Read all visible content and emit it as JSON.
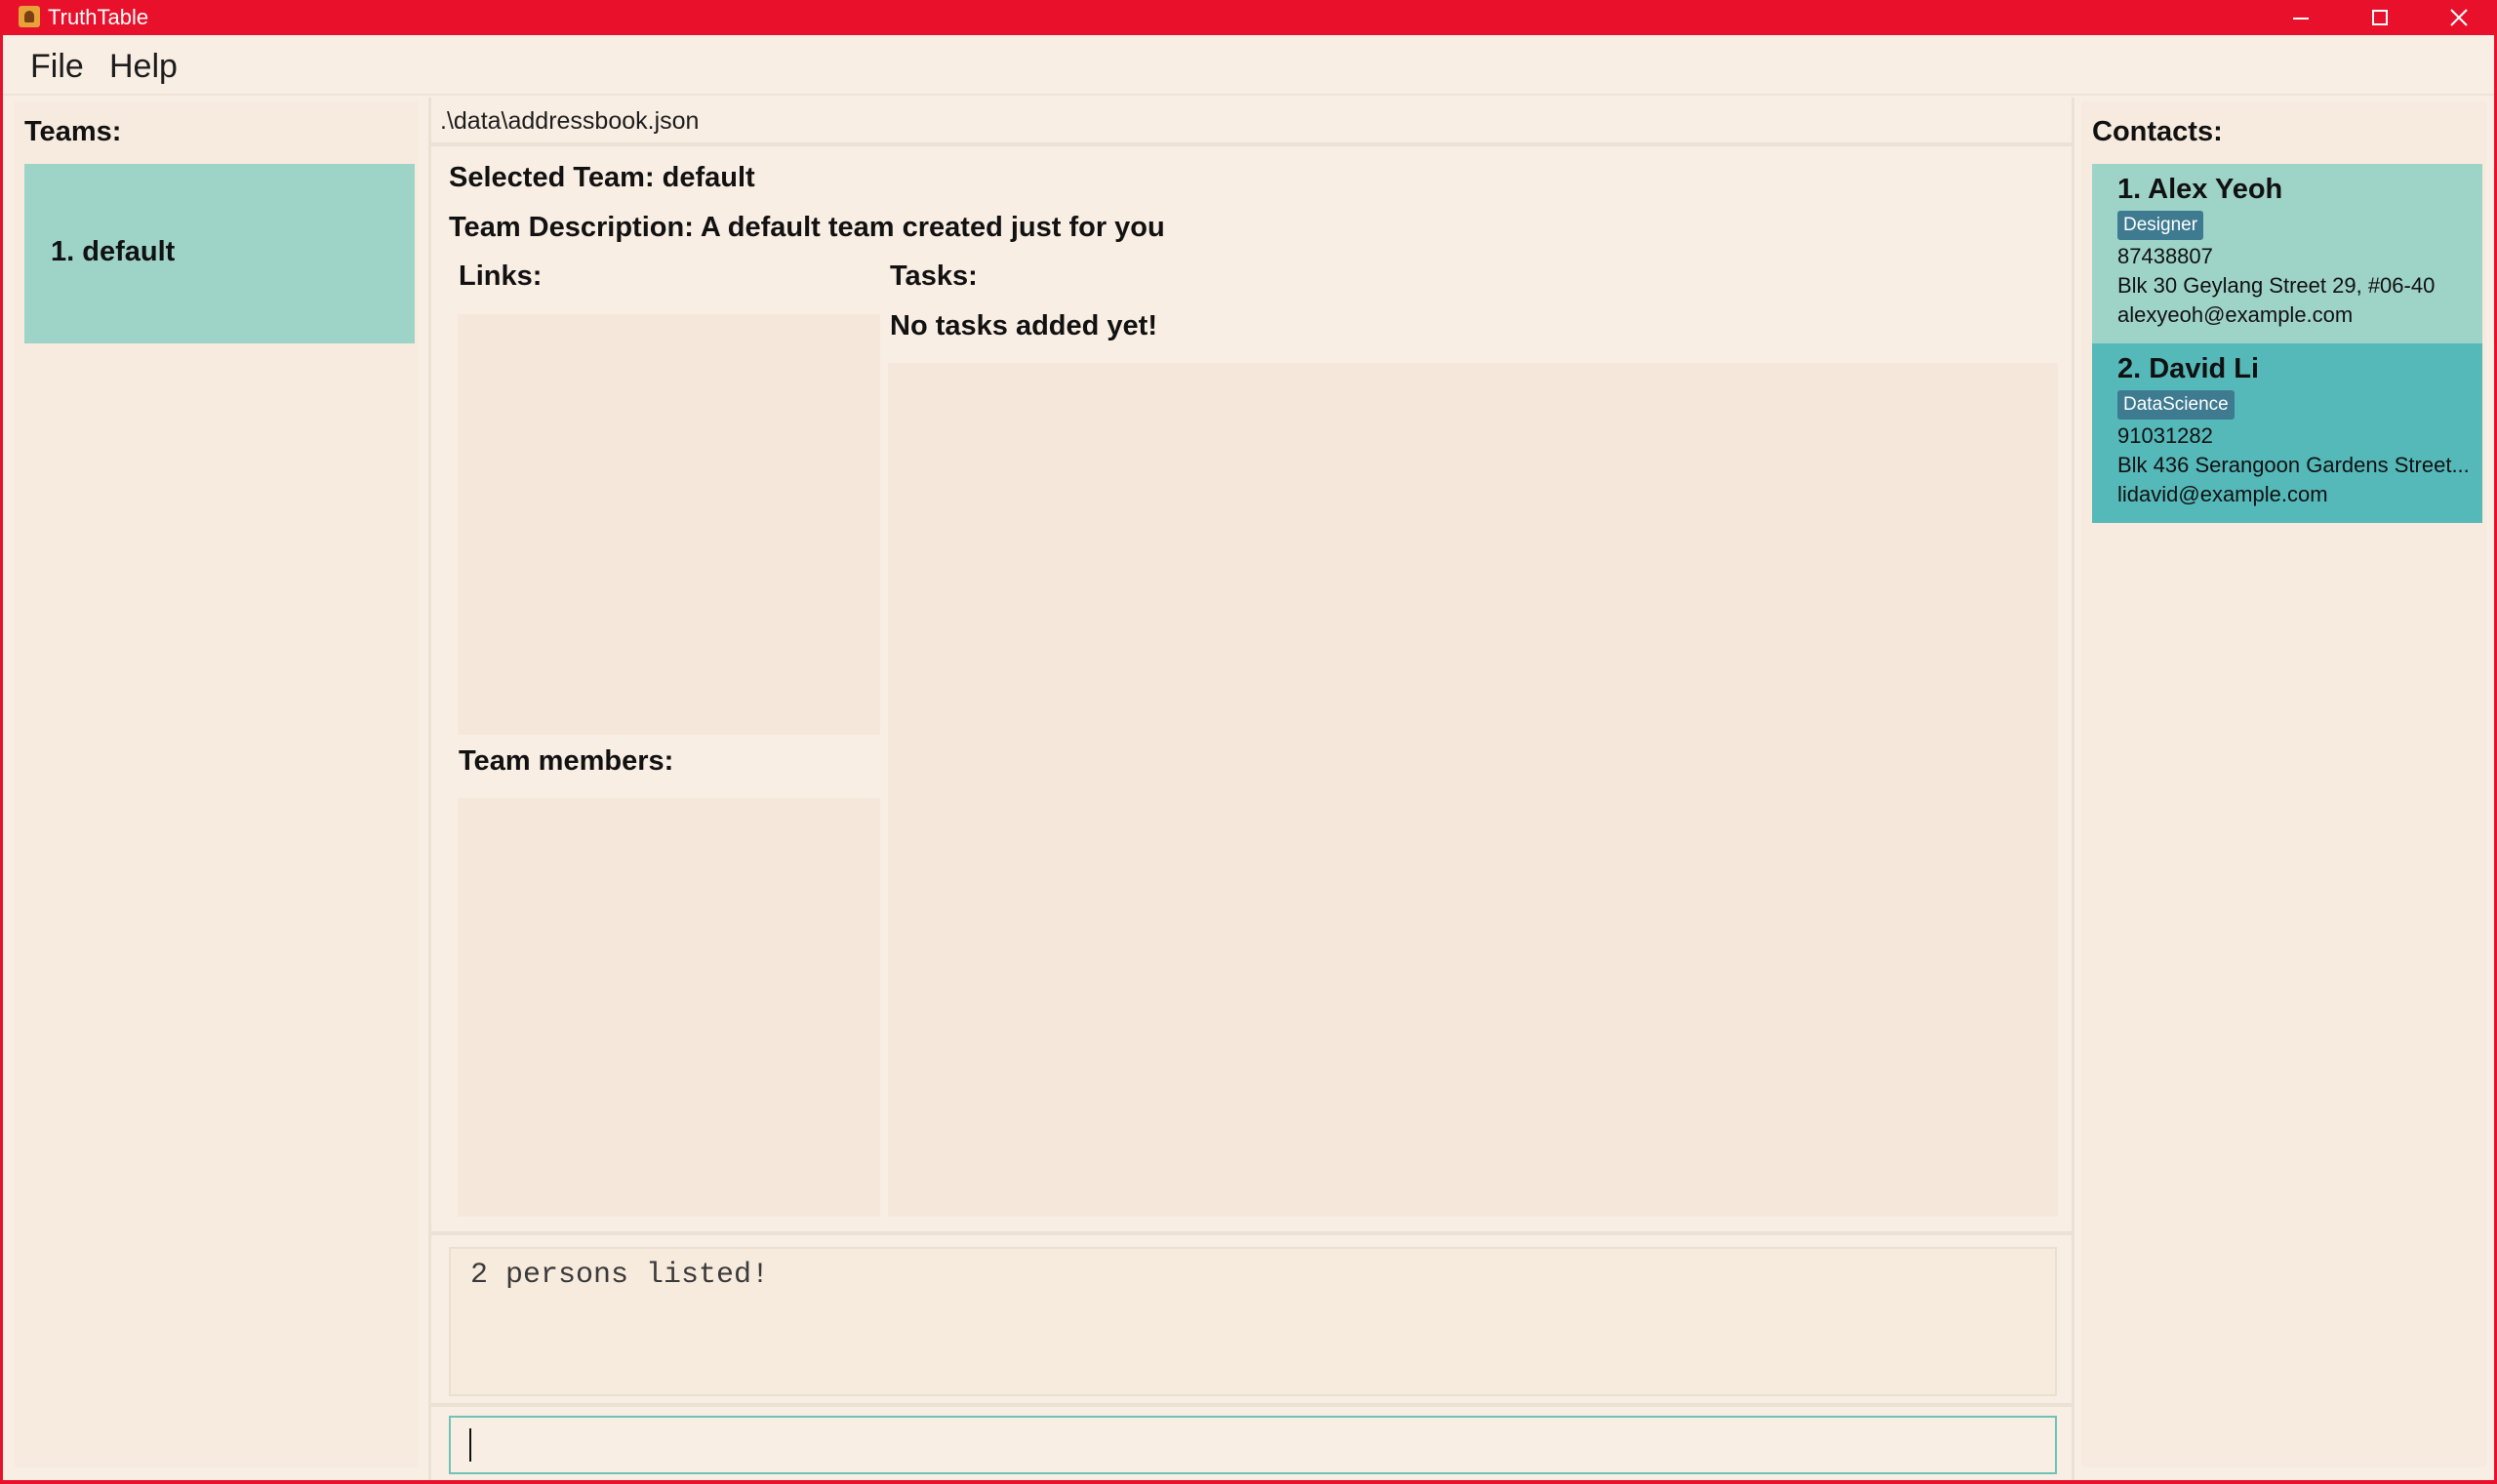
{
  "window": {
    "title": "TruthTable",
    "controls": [
      "minimize-icon",
      "maximize-icon",
      "close-icon"
    ],
    "titlebar_color": "#e8102a"
  },
  "menu": {
    "file": "File",
    "help": "Help"
  },
  "teams": {
    "heading": "Teams:",
    "items": [
      {
        "label": "1. default"
      }
    ]
  },
  "main": {
    "file_path": ".\\data\\addressbook.json",
    "selected_team": "Selected Team: default",
    "team_description": "Team Description: A default team created just for you",
    "links_heading": "Links:",
    "tasks_heading": "Tasks:",
    "no_tasks": "No tasks added yet!",
    "members_heading": "Team members:",
    "result_text": "2 persons listed!",
    "command_value": ""
  },
  "contacts": {
    "heading": "Contacts:",
    "items": [
      {
        "name": "1. Alex Yeoh",
        "tag": "Designer",
        "phone": "87438807",
        "address": "Blk 30 Geylang Street 29, #06-40",
        "email": "alexyeoh@example.com"
      },
      {
        "name": "2. David Li",
        "tag": "DataScience",
        "phone": "91031282",
        "address": "Blk 436 Serangoon Gardens Street...",
        "email": "lidavid@example.com"
      }
    ]
  },
  "colors": {
    "accent": "#9ed3c8",
    "selected_contact": "#55b8b9",
    "tag": "#3e7b91",
    "background": "#f9eee4"
  }
}
